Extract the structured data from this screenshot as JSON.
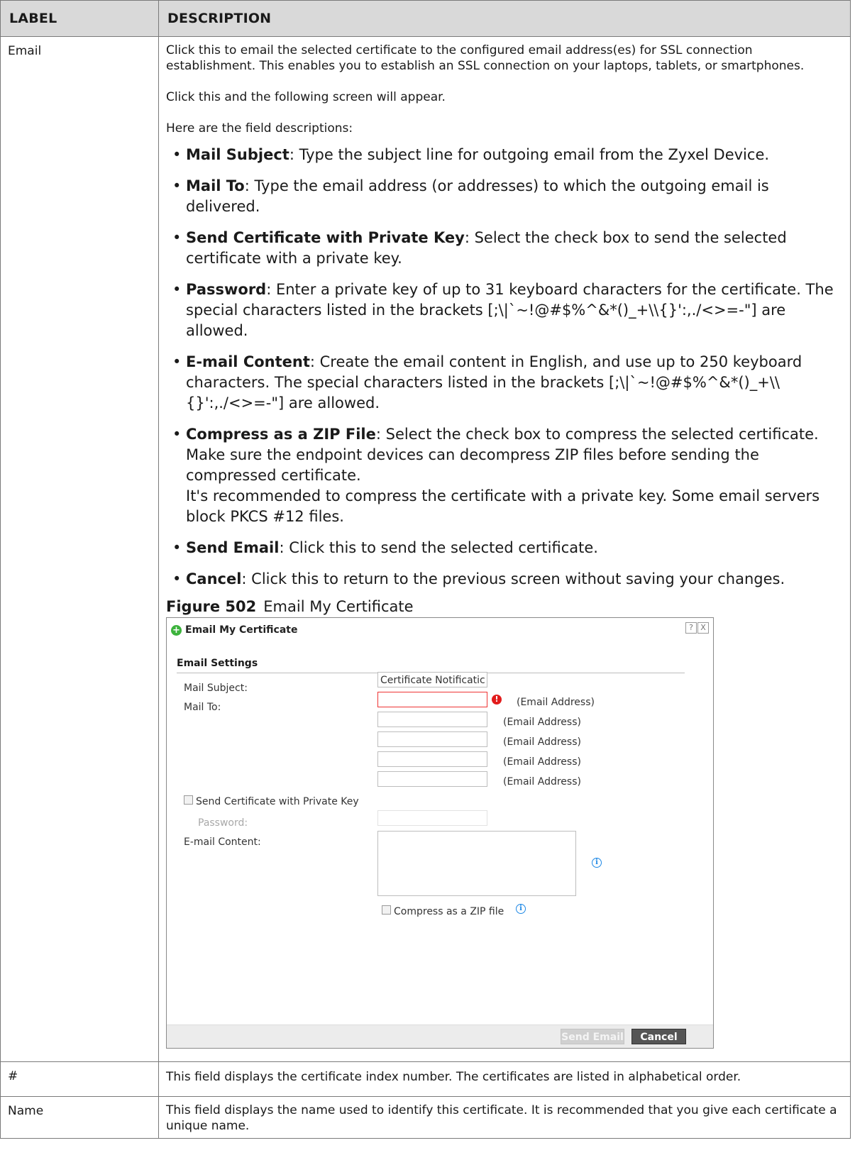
{
  "header": {
    "label": "LABEL",
    "description": "DESCRIPTION"
  },
  "email_row": {
    "label": "Email",
    "p1": "Click this to email the selected certificate to the configured email address(es) for SSL connection establishment. This enables you to establish an SSL connection on your laptops, tablets, or smartphones.",
    "p2": "Click this and the following screen will appear.",
    "p3": "Here are the field descriptions:",
    "fields": [
      {
        "name": "Mail Subject",
        "text": ": Type the subject line for outgoing email from the Zyxel Device."
      },
      {
        "name": "Mail To",
        "text": ": Type the email address (or addresses) to which the outgoing email is delivered."
      },
      {
        "name": "Send Certificate with Private Key",
        "text": ": Select the check box to send the selected certificate with a private key."
      },
      {
        "name": "Password",
        "text": ": Enter a private key of up to 31 keyboard characters for the certificate. The special characters listed in the brackets [;\\|`~!@#$%^&*()_+\\\\{}':,./<>=-\"] are allowed."
      },
      {
        "name": "E-mail Content",
        "text": ": Create the email content in English, and use up to 250 keyboard characters. The special characters listed in the brackets [;\\|`~!@#$%^&*()_+\\\\{}':,./<>=-\"] are allowed."
      },
      {
        "name": "Compress as a ZIP File",
        "text": ": Select the check box to compress the selected certificate.\nMake sure the endpoint devices can decompress ZIP files before sending the compressed certificate.\nIt's recommended to compress the certificate with a private key. Some email servers block PKCS #12 files."
      },
      {
        "name": "Send Email",
        "text": ": Click this to send the selected certificate."
      },
      {
        "name": "Cancel",
        "text": ": Click this to return to the previous screen without saving your changes."
      }
    ],
    "figure_num": "Figure 502",
    "figure_title": "Email My Certificate"
  },
  "dialog": {
    "title": "Email My Certificate",
    "help_btn": "?",
    "close_btn": "X",
    "section": "Email Settings",
    "mail_subject_label": "Mail Subject:",
    "mail_subject_value": "Certificate Notificatic",
    "mail_to_label": "Mail To:",
    "email_address_hint": "(Email Address)",
    "send_key_label": "Send Certificate with Private Key",
    "password_label": "Password:",
    "content_label": "E-mail Content:",
    "compress_label": "Compress as a ZIP file",
    "send_button": "Send Email",
    "cancel_button": "Cancel"
  },
  "index_row": {
    "label": "#",
    "text": "This field displays the certificate index number. The certificates are listed in alphabetical order."
  },
  "name_row": {
    "label": "Name",
    "text": "This field displays the name used to identify this certificate. It is recommended that you give each certificate a unique name."
  }
}
